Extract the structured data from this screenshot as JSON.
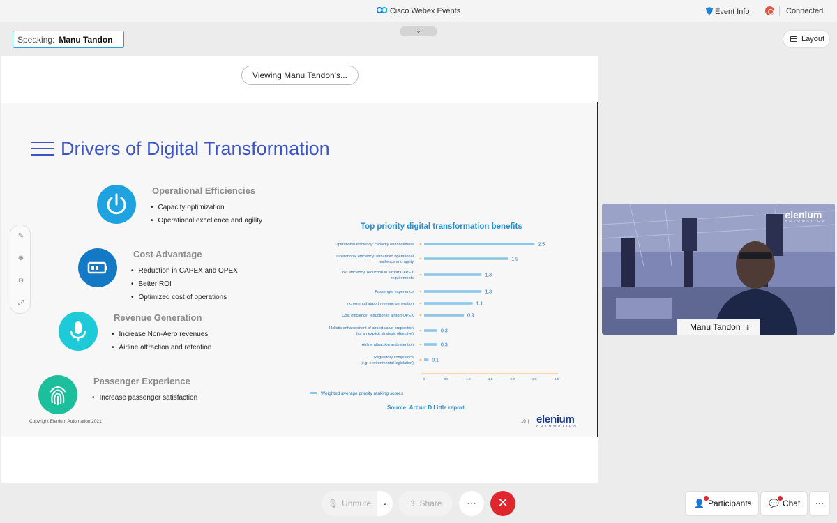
{
  "window": {
    "app_title": "Cisco Webex Events",
    "event_info": "Event Info",
    "status": "Connected"
  },
  "header": {
    "speaking_label": "Speaking:",
    "speaker_name": "Manu Tandon",
    "layout_label": "Layout"
  },
  "share": {
    "viewing_label": "Viewing Manu Tandon's..."
  },
  "slide": {
    "title": "Drivers of Digital Transformation",
    "drivers": [
      {
        "heading": "Operational Efficiencies",
        "icon": "power-icon",
        "color": "#1fa3e0",
        "bullets": [
          "Capacity optimization",
          "Operational excellence and agility"
        ]
      },
      {
        "heading": "Cost Advantage",
        "icon": "battery-icon",
        "color": "#1479c4",
        "bullets": [
          "Reduction in CAPEX and OPEX",
          "Better ROI",
          "Optimized cost of operations"
        ]
      },
      {
        "heading": "Revenue Generation",
        "icon": "microphone-icon",
        "color": "#1ec9d8",
        "bullets": [
          "Increase Non-Aero revenues",
          "Airline attraction and retention"
        ]
      },
      {
        "heading": "Passenger Experience",
        "icon": "fingerprint-icon",
        "color": "#1bbf9c",
        "bullets": [
          "Increase passenger satisfaction"
        ]
      }
    ],
    "copyright": "Copyright Elenium Automation 2021",
    "page_number": "10",
    "brand": "elenium",
    "brand_sub": "AUTOMATION"
  },
  "chart_data": {
    "type": "bar",
    "title": "Top priority digital transformation benefits",
    "categories": [
      "Operational efficiency: capacity enhancement",
      "Operational efficiency: enhanced operational resilience and agility",
      "Cost efficiency: reduction in airport CAPEX requirements",
      "Passenger experience",
      "Incremental airport revenue generation",
      "Cost efficiency: reduction in airport OPEX",
      "Holistic enhancement of airport value proposition (as an explicit strategic objective)",
      "Airline attraction and retention",
      "Regulatory compliance (e.g. environmental legislation)"
    ],
    "category_lines": [
      [
        "Operational efficiency: capacity enhancement"
      ],
      [
        "Operational efficiency: enhanced operational",
        "resilience and agility"
      ],
      [
        "Cost efficiency: reduction in airport CAPEX",
        "requirements"
      ],
      [
        "Passenger experience"
      ],
      [
        "Incremental airport revenue generation"
      ],
      [
        "Cost efficiency: reduction in airport OPEX"
      ],
      [
        "Holistic enhancement of airport value proposition",
        "(as an explicit strategic objective)"
      ],
      [
        "Airline attraction and retention"
      ],
      [
        "Regulatory compliance",
        "(e.g. environmental legislation)"
      ]
    ],
    "values": [
      2.5,
      1.9,
      1.3,
      1.3,
      1.1,
      0.9,
      0.3,
      0.3,
      0.1
    ],
    "value_labels": [
      "2.5",
      "1.9",
      "1.3",
      "1.3",
      "1.1",
      "0.9",
      "0.3",
      "0.3",
      "0.1"
    ],
    "xlim": [
      0,
      3.0
    ],
    "xticks": [
      "0",
      "0.5",
      "1.0",
      "1.5",
      "2.0",
      "2.5",
      "3.0"
    ],
    "orientation": "horizontal",
    "legend": "Weighted average priority ranking scores",
    "source": "Source: Arthur D Little report",
    "colors": {
      "bar": "#8ec6e8",
      "axis": "#f0b85a",
      "label": "#1f6fb5"
    }
  },
  "video": {
    "participant_name": "Manu Tandon",
    "overlay_brand": "elenium",
    "overlay_brand_sub": "AUTOMATION"
  },
  "controls": {
    "unmute": "Unmute",
    "share": "Share",
    "more": "⋯",
    "participants": "Participants",
    "chat": "Chat"
  },
  "colors": {
    "accent": "#2a9cde",
    "end_call": "#e0262d",
    "title_blue": "#3b54c8"
  }
}
